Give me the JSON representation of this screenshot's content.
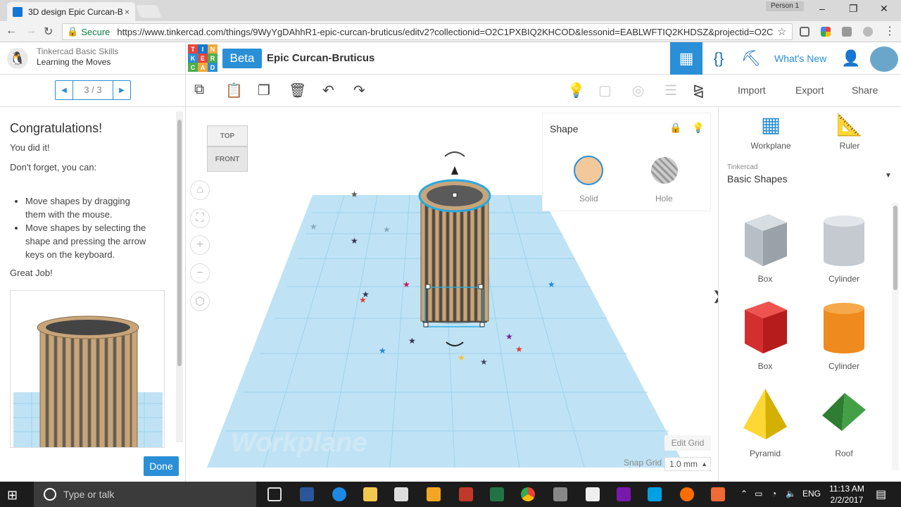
{
  "browser": {
    "tab_title": "3D design Epic Curcan-B",
    "tab_close": "×",
    "person": "Person 1",
    "secure_label": "Secure",
    "url": "https://www.tinkercad.com/things/9WyYgDAhhR1-epic-curcan-bruticus/editv2?collectionid=O2C1PXBIQ2KHCOD&lessonid=EABLWFTIQ2KHDSZ&projectid=O2C",
    "win_min": "–",
    "win_max": "❐",
    "win_close": "✕",
    "back": "←",
    "forward": "→",
    "reload": "↻",
    "star": "☆"
  },
  "lesson": {
    "course": "Tinkercad Basic Skills",
    "title": "Learning the Moves",
    "pager_prev": "◀",
    "pager_text": "3 / 3",
    "pager_next": "▶",
    "heading": "Congratulations!",
    "p1": "You did it!",
    "p2": "Don't forget, you can:",
    "bullets": [
      "Move shapes by dragging them with the mouse.",
      "Move shapes by selecting the shape and pressing the arrow keys on the keyboard."
    ],
    "p3": "Great Job!",
    "done": "Done"
  },
  "app": {
    "logo_letters": [
      "TIN",
      "KER",
      "CAD"
    ],
    "beta": "Beta",
    "design_title": "Epic Curcan-Bruticus",
    "whats_new": "What's New",
    "import": "Import",
    "export": "Export",
    "share": "Share"
  },
  "workspace": {
    "viewcube_top": "TOP",
    "viewcube_front": "FRONT",
    "workplane_watermark": "Workplane",
    "edit_grid": "Edit Grid",
    "snap_grid": "Snap Grid",
    "snap_value": "1.0 mm",
    "shape_panel": {
      "title": "Shape",
      "solid": "Solid",
      "hole": "Hole",
      "solid_color": "#f2c99a"
    }
  },
  "library": {
    "workplane": "Workplane",
    "ruler": "Ruler",
    "category_label": "Tinkercad",
    "category": "Basic Shapes",
    "shapes": [
      {
        "label": "Box",
        "icon": "box-hole-icon"
      },
      {
        "label": "Cylinder",
        "icon": "cylinder-hole-icon"
      },
      {
        "label": "Box",
        "icon": "box-red-icon"
      },
      {
        "label": "Cylinder",
        "icon": "cylinder-orange-icon"
      },
      {
        "label": "Pyramid",
        "icon": "pyramid-icon"
      },
      {
        "label": "Roof",
        "icon": "roof-icon"
      }
    ]
  },
  "taskbar": {
    "search_placeholder": "Type or talk",
    "lang": "ENG",
    "time": "11:13 AM",
    "date": "2/2/2017"
  },
  "colors": {
    "accent": "#2a8fd6",
    "grid": "#bfe3f5"
  }
}
